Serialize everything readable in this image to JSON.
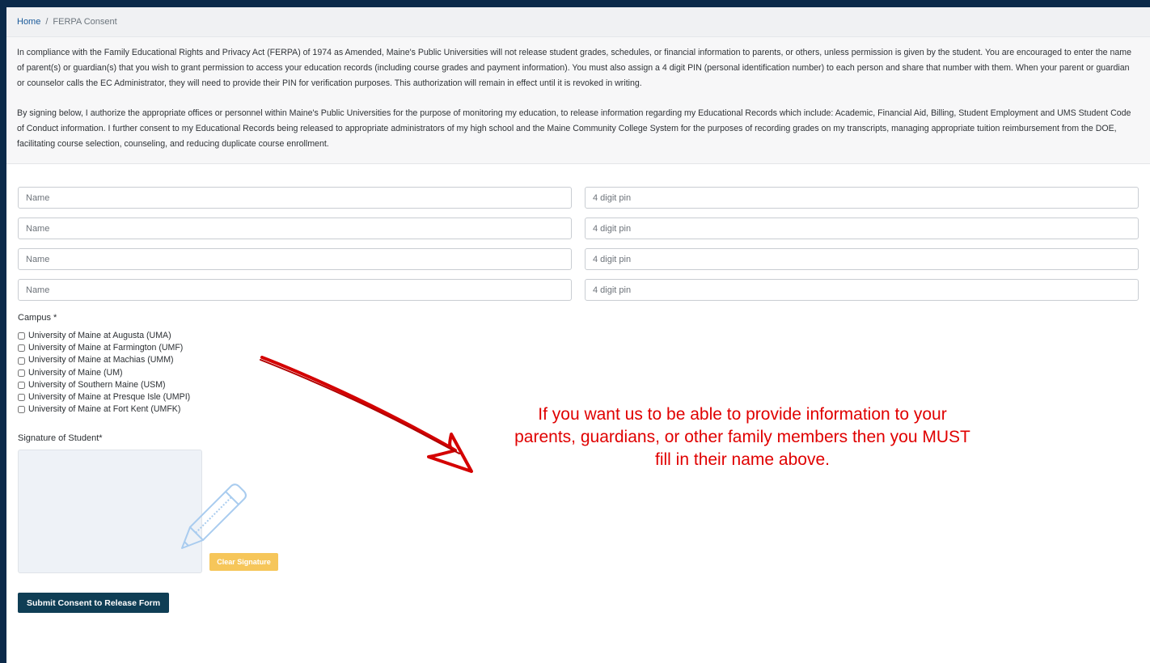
{
  "breadcrumb": {
    "home": "Home",
    "separator": "/",
    "current": "FERPA Consent"
  },
  "intro": {
    "paragraph1": "In compliance with the Family Educational Rights and Privacy Act (FERPA) of 1974 as Amended, Maine's Public Universities will not release student grades, schedules, or financial information to parents, or others, unless permission is given by the student. You are encouraged to enter the name of parent(s) or guardian(s) that you wish to grant permission to access your education records (including course grades and payment information). You must also assign a 4 digit PIN (personal identification number) to each person and share that number with them. When your parent or guardian or counselor calls the EC Administrator, they will need to provide their PIN for verification purposes. This authorization will remain in effect until it is revoked in writing.",
    "paragraph2": "By signing below, I authorize the appropriate offices or personnel within Maine's Public Universities for the purpose of monitoring my education, to release information regarding my Educational Records which include: Academic, Financial Aid, Billing, Student Employment and UMS Student Code of Conduct information. I further consent to my Educational Records being released to appropriate administrators of my high school and the Maine Community College System for the purposes of recording grades on my transcripts, managing appropriate tuition reimbursement from the DOE, facilitating course selection, counseling, and reducing duplicate course enrollment."
  },
  "form": {
    "rows": [
      {
        "name_placeholder": "Name",
        "pin_placeholder": "4 digit pin"
      },
      {
        "name_placeholder": "Name",
        "pin_placeholder": "4 digit pin"
      },
      {
        "name_placeholder": "Name",
        "pin_placeholder": "4 digit pin"
      },
      {
        "name_placeholder": "Name",
        "pin_placeholder": "4 digit pin"
      }
    ],
    "campus_label": "Campus *",
    "campuses": [
      "University of Maine at Augusta (UMA)",
      "University of Maine at Farmington (UMF)",
      "University of Maine at Machias (UMM)",
      "University of Maine (UM)",
      "University of Southern Maine (USM)",
      "University of Maine at Presque Isle (UMPI)",
      "University of Maine at Fort Kent (UMFK)"
    ],
    "signature_label": "Signature of Student*",
    "clear_label": "Clear Signature",
    "submit_label": "Submit Consent to Release Form"
  },
  "annotation": {
    "text": "If you want us to be able to provide information to your parents, guardians, or other family members then you MUST fill in their name above.",
    "color": "#e00000"
  },
  "colors": {
    "page_bg": "#0b2a4a",
    "submit": "#0f3e55",
    "clear": "#f6c65a",
    "link": "#1a5a9a"
  }
}
